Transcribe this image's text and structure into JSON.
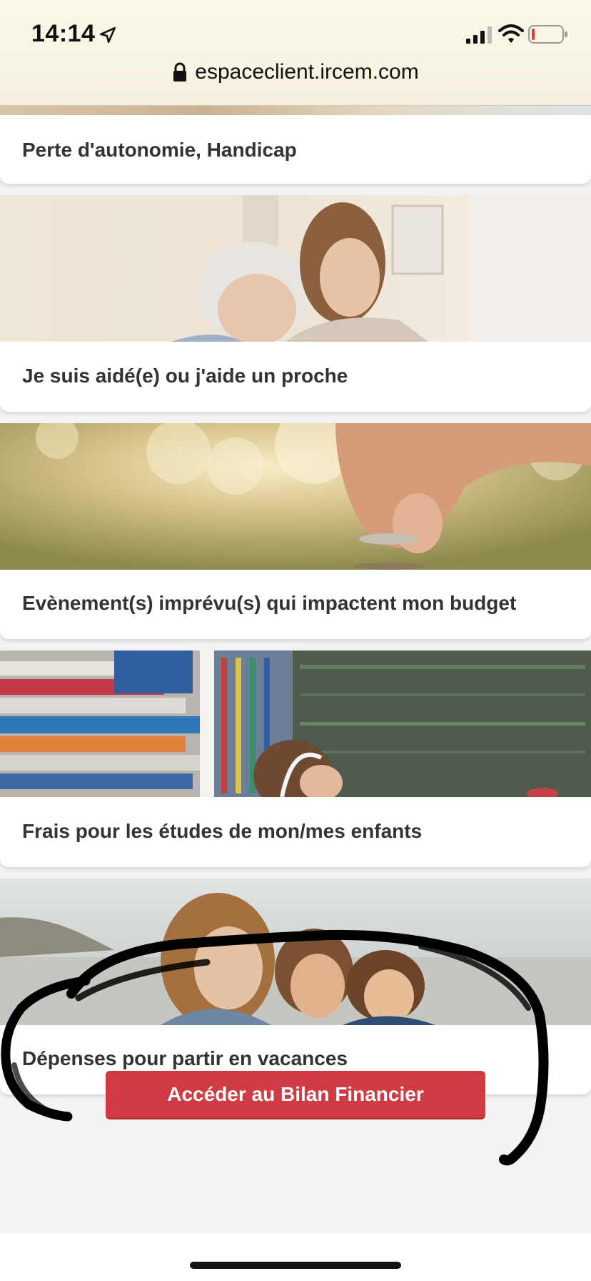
{
  "status_bar": {
    "time": "14:14",
    "location_icon": "location-arrow-icon",
    "signal_icon": "cellular-signal-icon",
    "wifi_icon": "wifi-icon",
    "battery_icon": "battery-low-icon",
    "battery_level": 0.1
  },
  "browser": {
    "url": "espaceclient.ircem.com",
    "lock_icon": "lock-icon"
  },
  "cards": [
    {
      "label": "Perte d'autonomie, Handicap"
    },
    {
      "label": "Je suis aidé(e) ou j'aide un proche"
    },
    {
      "label": "Evènement(s) imprévu(s) qui impactent mon budget"
    },
    {
      "label": "Frais pour les études de mon/mes enfants"
    },
    {
      "label": "Dépenses pour partir en vacances"
    }
  ],
  "cta": {
    "label": "Accéder au Bilan Financier",
    "color": "#cf3a43"
  },
  "annotation": {
    "type": "hand-drawn-circle",
    "color": "#000000"
  }
}
